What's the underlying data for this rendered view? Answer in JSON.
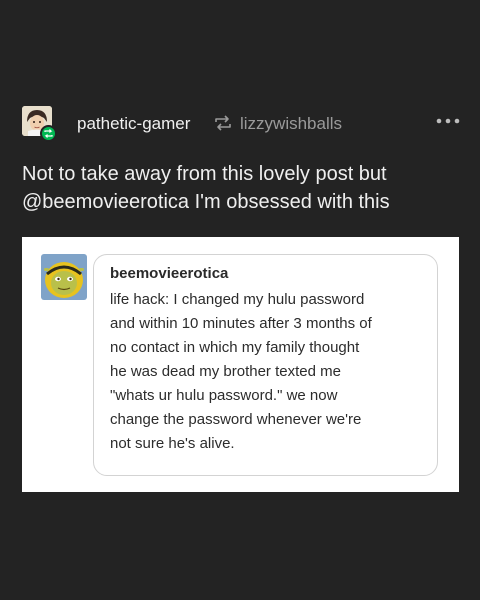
{
  "post": {
    "author": "pathetic-gamer",
    "reblogged_from": "lizzywishballs",
    "body_lines": [
      "Not to take away from this lovely post but",
      "@beemovieerotica I'm obsessed with this"
    ]
  },
  "screenshot": {
    "username": "beemovieerotica",
    "lines": [
      "life hack:  I changed my hulu password",
      "and within 10 minutes after 3 months of",
      "no contact in which my family thought",
      "he was dead my brother texted me",
      "\"whats ur hulu password.\" we now",
      "change the password whenever we're",
      "not sure he's alive."
    ]
  },
  "icons": {
    "author_avatar": "avatar-icon",
    "reblog_badge": "reblog-badge-icon",
    "reblog": "reblog-icon",
    "more": "more-options-icon",
    "screenshot_avatar": "shrek-bee-avatar-icon"
  },
  "colors": {
    "background": "#232323",
    "reblog_badge": "#00b852",
    "source_text": "#9a9a9a"
  }
}
